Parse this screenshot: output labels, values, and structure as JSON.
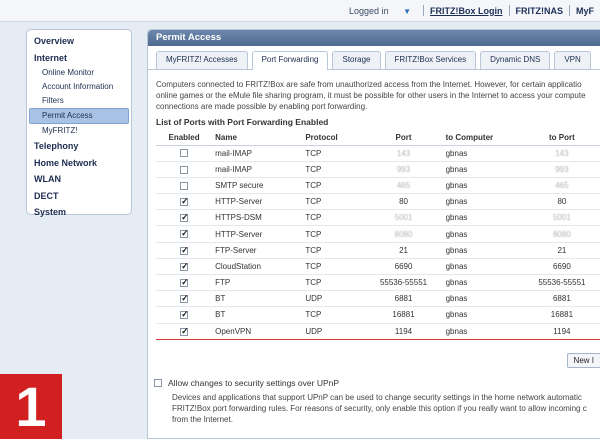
{
  "topbar": {
    "logged_in": "Logged in",
    "fritzbox_login": "FRITZ!Box Login",
    "fritznas": "FRITZ!NAS",
    "myfritz": "MyF"
  },
  "nav": {
    "items": [
      {
        "label": "Overview"
      },
      {
        "label": "Internet"
      },
      {
        "label": "Online Monitor"
      },
      {
        "label": "Account Information"
      },
      {
        "label": "Filters"
      },
      {
        "label": "Permit Access"
      },
      {
        "label": "MyFRITZ!"
      },
      {
        "label": "Telephony"
      },
      {
        "label": "Home Network"
      },
      {
        "label": "WLAN"
      },
      {
        "label": "DECT"
      },
      {
        "label": "System"
      }
    ]
  },
  "panel": {
    "title": "Permit Access",
    "tabs": [
      "MyFRITZ! Accesses",
      "Port Forwarding",
      "Storage",
      "FRITZ!Box Services",
      "Dynamic DNS",
      "VPN"
    ],
    "selected_tab": "Port Forwarding",
    "intro_lines": [
      "Computers connected to FRITZ!Box are safe from unauthorized access from the Internet. However, for certain applicatio",
      "online games or the eMule file sharing program, it must be possible for other users in the Internet to access your compute",
      "connections are made possible by enabling port forwarding."
    ],
    "list_title": "List of Ports with Port Forwarding Enabled",
    "columns": [
      "Enabled",
      "Name",
      "Protocol",
      "Port",
      "to Computer",
      "to Port"
    ],
    "rows": [
      {
        "enabled": false,
        "name": "mail-IMAP",
        "protocol": "TCP",
        "port": "143",
        "computer": "gbnas",
        "to_port": "143",
        "blurred": true
      },
      {
        "enabled": false,
        "name": "mail-IMAP",
        "protocol": "TCP",
        "port": "993",
        "computer": "gbnas",
        "to_port": "993",
        "blurred": true
      },
      {
        "enabled": false,
        "name": "SMTP secure",
        "protocol": "TCP",
        "port": "465",
        "computer": "gbnas",
        "to_port": "465",
        "blurred": true
      },
      {
        "enabled": true,
        "name": "HTTP-Server",
        "protocol": "TCP",
        "port": "80",
        "computer": "gbnas",
        "to_port": "80",
        "blurred": false
      },
      {
        "enabled": true,
        "name": "HTTPS-DSM",
        "protocol": "TCP",
        "port": "5001",
        "computer": "gbnas",
        "to_port": "5001",
        "blurred": true
      },
      {
        "enabled": true,
        "name": "HTTP-Server",
        "protocol": "TCP",
        "port": "8080",
        "computer": "gbnas",
        "to_port": "8080",
        "blurred": true
      },
      {
        "enabled": true,
        "name": "FTP-Server",
        "protocol": "TCP",
        "port": "21",
        "computer": "gbnas",
        "to_port": "21",
        "blurred": false
      },
      {
        "enabled": true,
        "name": "CloudStation",
        "protocol": "TCP",
        "port": "6690",
        "computer": "gbnas",
        "to_port": "6690",
        "blurred": false
      },
      {
        "enabled": true,
        "name": "FTP",
        "protocol": "TCP",
        "port": "55536-55551",
        "computer": "gbnas",
        "to_port": "55536-55551",
        "blurred": false
      },
      {
        "enabled": true,
        "name": "BT",
        "protocol": "UDP",
        "port": "6881",
        "computer": "gbnas",
        "to_port": "6881",
        "blurred": false
      },
      {
        "enabled": true,
        "name": "BT",
        "protocol": "TCP",
        "port": "16881",
        "computer": "gbnas",
        "to_port": "16881",
        "blurred": false
      },
      {
        "enabled": true,
        "name": "OpenVPN",
        "protocol": "UDP",
        "port": "1194",
        "computer": "gbnas",
        "to_port": "1194",
        "blurred": false,
        "highlight": true
      }
    ],
    "new_button": "New I",
    "upnp_label": "Allow changes to security settings over UPnP",
    "upnp_checked": false,
    "upnp_desc_lines": [
      "Devices and applications that support UPnP can be used to change security settings in the home network automatic",
      "FRITZ!Box port forwarding rules. For reasons of security, only enable this option if you really want to allow incoming c",
      "from the Internet."
    ]
  },
  "badge": {
    "number": "1",
    "color": "#d21f1f"
  }
}
